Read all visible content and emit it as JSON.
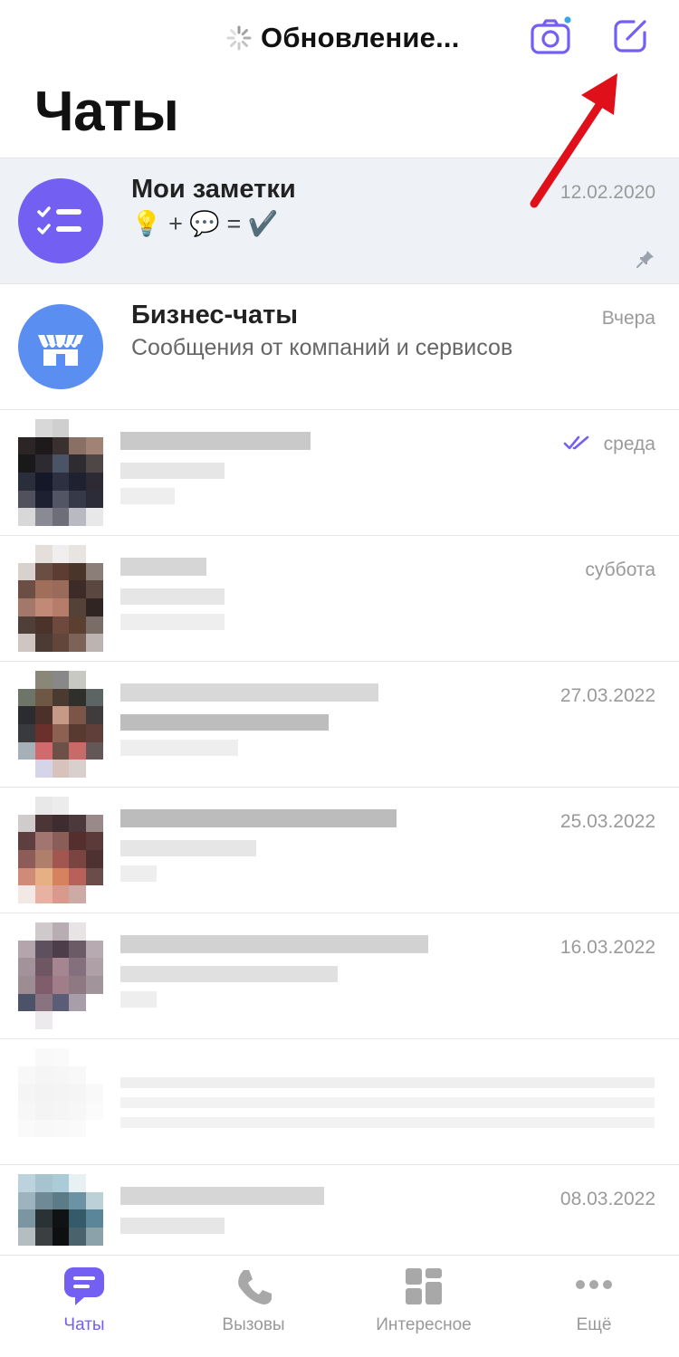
{
  "header": {
    "status_text": "Обновление...",
    "title": "Чаты"
  },
  "colors": {
    "accent": "#7360f2",
    "notes_avatar": "#7360f2",
    "business_avatar": "#5a8ef0",
    "pinned_row_bg": "#eef2f6",
    "annotation_arrow": "#e0101a"
  },
  "chats": [
    {
      "name": "Мои заметки",
      "message": "💡 + 💬 = ✔️",
      "date": "12.02.2020",
      "pinned": true
    },
    {
      "name": "Бизнес-чаты",
      "message": "Сообщения от компаний и сервисов",
      "date": "Вчера"
    },
    {
      "date": "среда",
      "read": true
    },
    {
      "date": "суббота"
    },
    {
      "date": "27.03.2022"
    },
    {
      "date": "25.03.2022"
    },
    {
      "date": "16.03.2022"
    },
    {
      "date": ""
    },
    {
      "date": "08.03.2022"
    }
  ],
  "tabbar": {
    "items": [
      {
        "label": "Чаты",
        "icon": "chat-bubble-icon",
        "active": true
      },
      {
        "label": "Вызовы",
        "icon": "phone-icon"
      },
      {
        "label": "Интересное",
        "icon": "grid-icon"
      },
      {
        "label": "Ещё",
        "icon": "more-icon"
      }
    ]
  }
}
